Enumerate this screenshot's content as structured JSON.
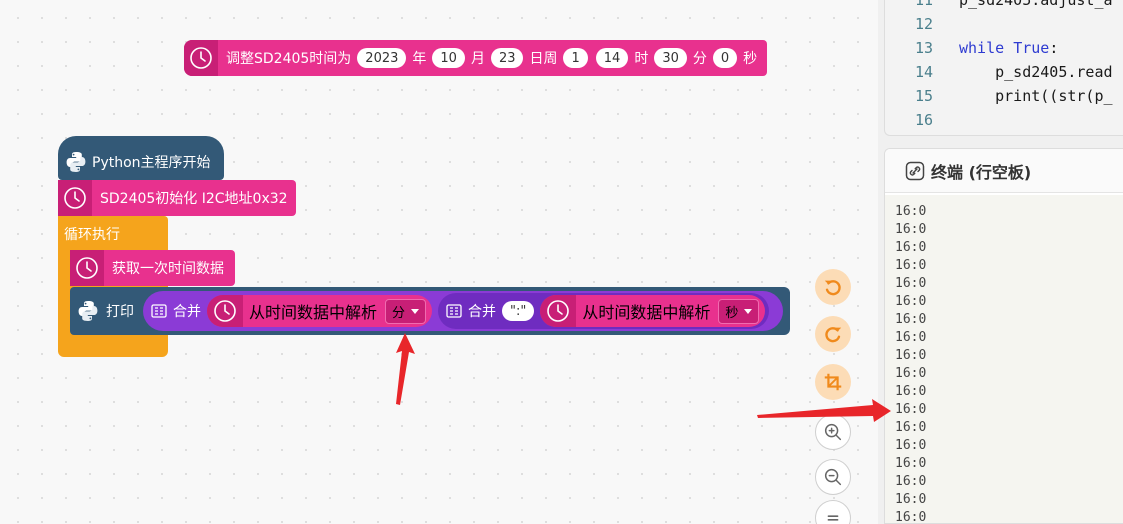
{
  "blocks": {
    "set_time": {
      "prefix": "调整SD2405时间为",
      "year": "2023",
      "year_unit": "年",
      "month": "10",
      "month_unit": "月",
      "day": "23",
      "day_unit": "日周",
      "weekday": "1",
      "hour": "14",
      "hour_unit": "时",
      "minute": "30",
      "minute_unit": "分",
      "second": "0",
      "second_unit": "秒"
    },
    "main_hat": "Python主程序开始",
    "init": "SD2405初始化 I2C地址0x32",
    "loop": "循环执行",
    "get_data": "获取一次时间数据",
    "print_label": "打印",
    "merge_label": "合并",
    "parse1": {
      "label": "从时间数据中解析",
      "selected": "分"
    },
    "separator": "\":\"",
    "parse2": {
      "label": "从时间数据中解析",
      "selected": "秒"
    }
  },
  "code": {
    "lines": [
      {
        "num": "11",
        "text": "p_sd2405.adjust_a"
      },
      {
        "num": "12",
        "text": ""
      },
      {
        "num": "13",
        "kw": "while",
        "text": " ",
        "kw2": "True",
        "rest": ":"
      },
      {
        "num": "14",
        "text": "    p_sd2405.read"
      },
      {
        "num": "15",
        "text": "    print((str(p_"
      },
      {
        "num": "16",
        "text": ""
      }
    ]
  },
  "terminal": {
    "title": "终端 (行空板)",
    "lines": [
      "16:0",
      "16:0",
      "16:0",
      "16:0",
      "16:0",
      "16:0",
      "16:0",
      "16:0",
      "16:0",
      "16:0",
      "16:0",
      "16:0",
      "16:0",
      "16:0",
      "16:0",
      "16:0",
      "16:0",
      "16:0"
    ]
  },
  "colors": {
    "block_pink": "#e8318e",
    "block_python": "#335977",
    "block_loop": "#f5a41c",
    "block_merge": "#8b3bd6",
    "arrow": "#e8262a"
  },
  "icons": {
    "clock": "clock-icon",
    "python": "python-logo-icon",
    "merge": "text-join-icon",
    "undo": "undo-icon",
    "redo": "redo-icon",
    "crop": "crop-icon",
    "zoom_in": "zoom-in-icon",
    "zoom_out": "zoom-out-icon",
    "reset": "reset-zoom-icon",
    "link": "link-icon"
  }
}
